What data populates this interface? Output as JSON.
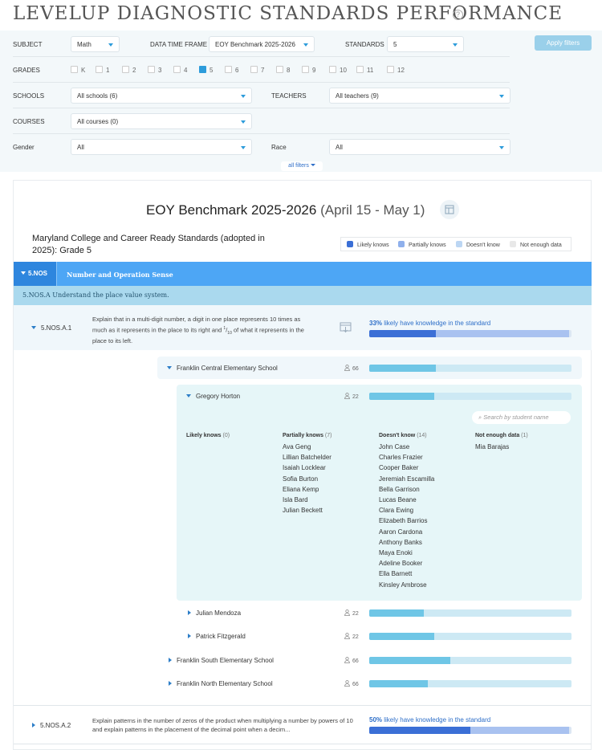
{
  "app": {
    "title": "LEVELUP DIAGNOSTIC STANDARDS PERFORMANCE",
    "help_icon": "?"
  },
  "filters": {
    "subject_label": "SUBJECT",
    "subject_value": "Math",
    "time_label": "DATA TIME FRAME",
    "time_value": "EOY Benchmark 2025-2026",
    "standards_label": "STANDARDS",
    "standards_value": "5",
    "apply_label": "Apply filters",
    "grades_label": "GRADES",
    "grades": [
      {
        "label": "K",
        "checked": false
      },
      {
        "label": "1",
        "checked": false
      },
      {
        "label": "2",
        "checked": false
      },
      {
        "label": "3",
        "checked": false
      },
      {
        "label": "4",
        "checked": false
      },
      {
        "label": "5",
        "checked": true
      },
      {
        "label": "6",
        "checked": false
      },
      {
        "label": "7",
        "checked": false
      },
      {
        "label": "8",
        "checked": false
      },
      {
        "label": "9",
        "checked": false
      },
      {
        "label": "10",
        "checked": false
      },
      {
        "label": "11",
        "checked": false
      },
      {
        "label": "12",
        "checked": false
      }
    ],
    "schools_label": "SCHOOLS",
    "schools_value": "All schools (6)",
    "teachers_label": "TEACHERS",
    "teachers_value": "All teachers (9)",
    "courses_label": "COURSES",
    "courses_value": "All courses (0)",
    "gender_label": "Gender",
    "gender_value": "All",
    "race_label": "Race",
    "race_value": "All",
    "all_filters_label": "all filters"
  },
  "report": {
    "title": "EOY Benchmark 2025-2026",
    "date_range": "(April 15 - May 1)",
    "standard_set": "Maryland College and Career Ready Standards (adopted in 2025): Grade 5",
    "legend": [
      {
        "label": "Likely knows",
        "color": "#3b6fd6"
      },
      {
        "label": "Partially knows",
        "color": "#8fb0ec"
      },
      {
        "label": "Doesn't know",
        "color": "#bcd6f3"
      },
      {
        "label": "Not enough data",
        "color": "#e8e8e8"
      }
    ],
    "domain_code": "5.NOS",
    "domain_name": "Number and Operation Sense",
    "cluster": "5.NOS.A Understand the place value system.",
    "standards": [
      {
        "code": "5.NOS.A.1",
        "desc_pre": "Explain that in a multi-digit number, a digit in one place represents 10 times as much as it represents in the place to its right and ",
        "frac_num": "1",
        "frac_den": "10",
        "desc_post": " of what it represents in the place to its left.",
        "summary_pct": "33%",
        "summary_text": "likely have knowledge in the standard",
        "likely": 0.33,
        "partial": 0.67
      },
      {
        "code": "5.NOS.A.2",
        "desc": "Explain patterns in the number of zeros of the product when multiplying a number by powers of 10 and explain patterns in the placement of the decimal point when a decim...",
        "summary_pct": "50%",
        "summary_text": "likely have knowledge in the standard",
        "likely": 0.5,
        "partial": 0.5
      }
    ],
    "schools": [
      {
        "name": "Franklin Central Elementary School",
        "count": "66",
        "fill": 0.33,
        "expanded": true
      },
      {
        "name": "Franklin South Elementary School",
        "count": "66",
        "fill": 0.4
      },
      {
        "name": "Franklin North Elementary School",
        "count": "66",
        "fill": 0.29
      }
    ],
    "teachers": [
      {
        "name": "Gregory Horton",
        "count": "22",
        "fill": 0.32,
        "expanded": true
      },
      {
        "name": "Julian Mendoza",
        "count": "22",
        "fill": 0.27
      },
      {
        "name": "Patrick Fitzgerald",
        "count": "22",
        "fill": 0.32
      }
    ],
    "search_placeholder": "Search by student name",
    "groups": {
      "likely": {
        "label": "Likely knows",
        "count": "(0)",
        "students": []
      },
      "partial": {
        "label": "Partially knows",
        "count": "(7)",
        "students": [
          "Ava Geng",
          "Lillian Batchelder",
          "Isaiah Locklear",
          "Sofia Burton",
          "Eliana Kemp",
          "Isla Bard",
          "Julian Beckett"
        ]
      },
      "doesnt": {
        "label": "Doesn't know",
        "count": "(14)",
        "students": [
          "John Case",
          "Charles Frazier",
          "Cooper Baker",
          "Jeremiah Escamilla",
          "Bella Garrison",
          "Lucas Beane",
          "Clara Ewing",
          "Elizabeth Barrios",
          "Aaron Cardona",
          "Anthony Banks",
          "Maya Enoki",
          "Adeline Booker",
          "Ella Barnett",
          "Kinsley Ambrose"
        ]
      },
      "notenough": {
        "label": "Not enough data",
        "count": "(1)",
        "students": [
          "Mia Barajas"
        ]
      }
    }
  }
}
